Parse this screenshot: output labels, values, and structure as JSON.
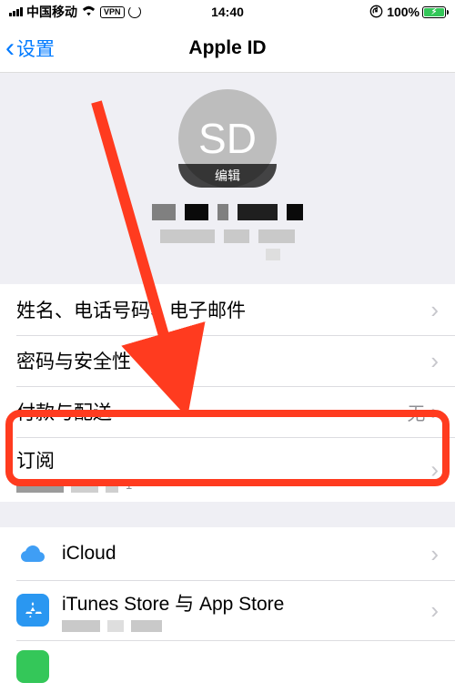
{
  "status": {
    "carrier": "中国移动",
    "vpn": "VPN",
    "time": "14:40",
    "battery_pct": "100%"
  },
  "nav": {
    "back_label": "设置",
    "title": "Apple ID"
  },
  "profile": {
    "initials": "SD",
    "edit_label": "编辑"
  },
  "rows": {
    "name_phone_email": "姓名、电话号码、电子邮件",
    "password_security": "密码与安全性",
    "payment_shipping": "付款与配送",
    "payment_value": "无",
    "subscriptions": "订阅"
  },
  "services": {
    "icloud": "iCloud",
    "itunes": "iTunes Store 与 App Store"
  }
}
